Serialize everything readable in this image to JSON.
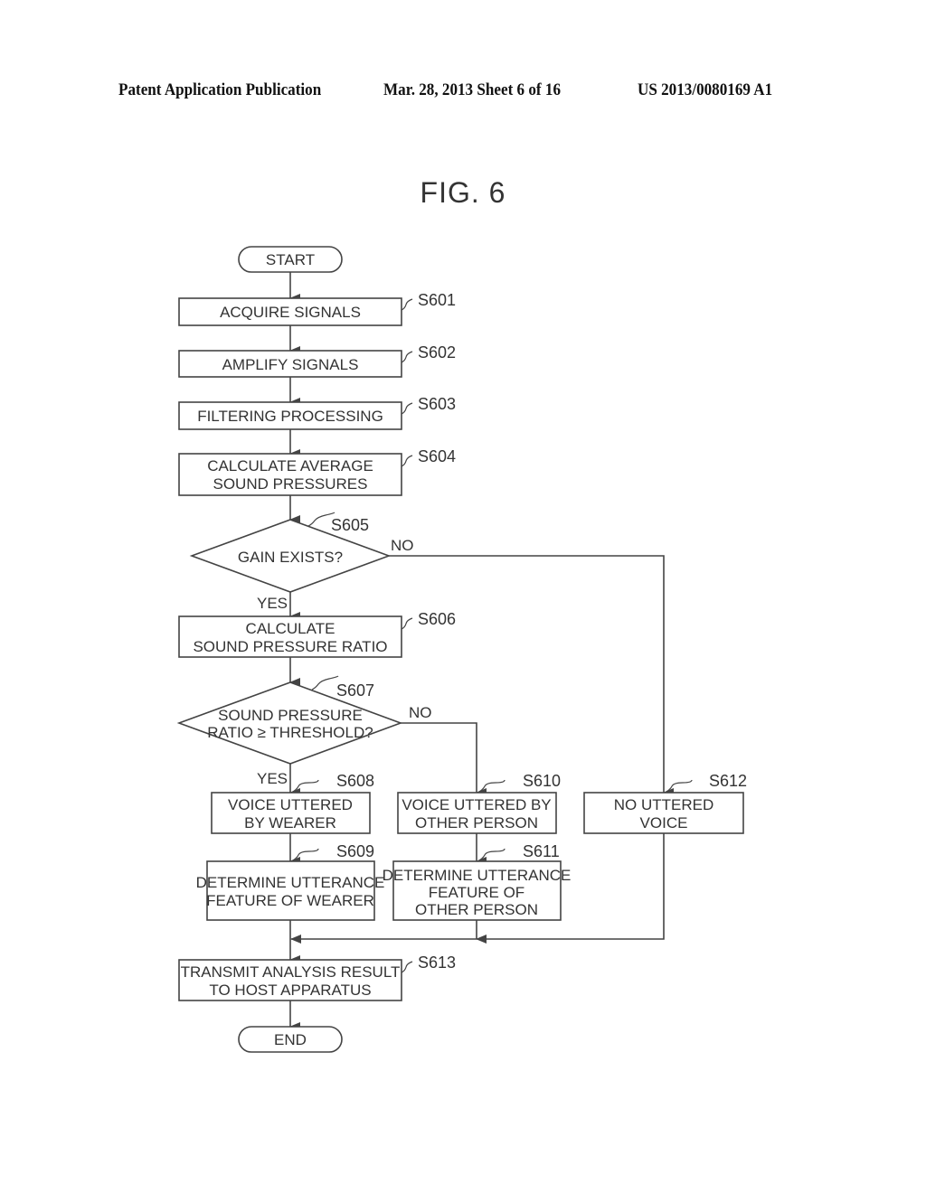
{
  "header": {
    "left": "Patent Application Publication",
    "middle": "Mar. 28, 2013  Sheet 6 of 16",
    "right": "US 2013/0080169 A1"
  },
  "figure": {
    "title": "FIG. 6"
  },
  "flowchart": {
    "start": "START",
    "end": "END",
    "steps": {
      "s601": {
        "id": "S601",
        "lines": [
          "ACQUIRE SIGNALS"
        ]
      },
      "s602": {
        "id": "S602",
        "lines": [
          "AMPLIFY SIGNALS"
        ]
      },
      "s603": {
        "id": "S603",
        "lines": [
          "FILTERING PROCESSING"
        ]
      },
      "s604": {
        "id": "S604",
        "lines": [
          "CALCULATE AVERAGE",
          "SOUND PRESSURES"
        ]
      },
      "s605": {
        "id": "S605",
        "lines": [
          "GAIN EXISTS?"
        ]
      },
      "s606": {
        "id": "S606",
        "lines": [
          "CALCULATE",
          "SOUND PRESSURE RATIO"
        ]
      },
      "s607": {
        "id": "S607",
        "lines": [
          "SOUND PRESSURE",
          "RATIO ≥ THRESHOLD?"
        ]
      },
      "s608": {
        "id": "S608",
        "lines": [
          "VOICE UTTERED",
          "BY WEARER"
        ]
      },
      "s609": {
        "id": "S609",
        "lines": [
          "DETERMINE UTTERANCE",
          "FEATURE OF WEARER"
        ]
      },
      "s610": {
        "id": "S610",
        "lines": [
          "VOICE UTTERED BY",
          "OTHER PERSON"
        ]
      },
      "s611": {
        "id": "S611",
        "lines": [
          "DETERMINE UTTERANCE",
          "FEATURE OF",
          "OTHER PERSON"
        ]
      },
      "s612": {
        "id": "S612",
        "lines": [
          "NO UTTERED",
          "VOICE"
        ]
      },
      "s613": {
        "id": "S613",
        "lines": [
          "TRANSMIT ANALYSIS RESULT",
          "TO HOST APPARATUS"
        ]
      }
    },
    "branches": {
      "s605_yes": "YES",
      "s605_no": "NO",
      "s607_yes": "YES",
      "s607_no": "NO"
    }
  }
}
